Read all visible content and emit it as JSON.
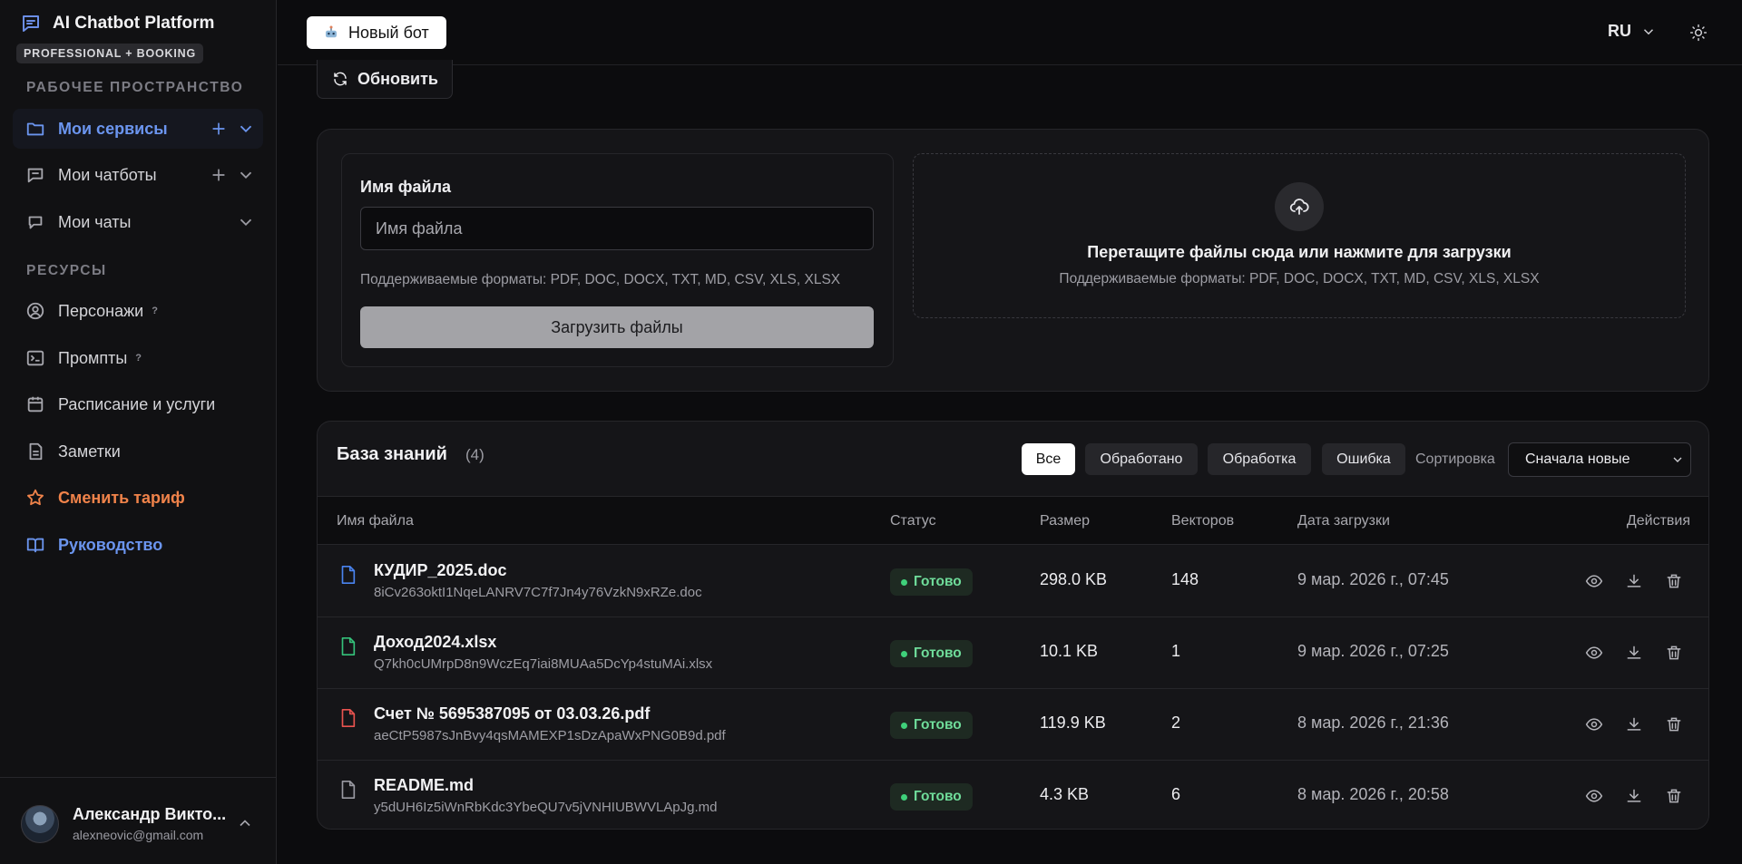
{
  "app": {
    "title": "AI Chatbot Platform",
    "plan_badge": "PROFESSIONAL + BOOKING"
  },
  "sidebar": {
    "workspace_label": "РАБОЧЕЕ ПРОСТРАНСТВО",
    "workspace_items": [
      {
        "label": "Мои сервисы",
        "icon": "folder-icon"
      },
      {
        "label": "Мои чатботы",
        "icon": "chat-icon"
      },
      {
        "label": "Мои чаты",
        "icon": "chat-bubble-icon"
      }
    ],
    "resources_label": "РЕСУРСЫ",
    "resource_items": [
      {
        "label": "Персонажи",
        "help": "?",
        "icon": "person-icon"
      },
      {
        "label": "Промпты",
        "help": "?",
        "icon": "terminal-icon"
      },
      {
        "label": "Расписание и услуги",
        "icon": "calendar-icon"
      },
      {
        "label": "Заметки",
        "icon": "note-icon"
      },
      {
        "label": "Сменить тариф",
        "icon": "star-icon"
      },
      {
        "label": "Руководство",
        "icon": "book-icon"
      }
    ],
    "user": {
      "name": "Александр Викто...",
      "email": "alexneovic@gmail.com"
    }
  },
  "topbar": {
    "new_bot_label": "Новый бот",
    "language": "RU"
  },
  "toolbar": {
    "refresh_label": "Обновить"
  },
  "upload": {
    "field_label": "Имя файла",
    "field_placeholder": "Имя файла",
    "field_value": "",
    "formats": "Поддерживаемые форматы: PDF, DOC, DOCX, TXT, MD, CSV, XLS, XLSX",
    "upload_button": "Загрузить файлы",
    "drop_title": "Перетащите файлы сюда или нажмите для загрузки",
    "drop_formats": "Поддерживаемые форматы: PDF, DOC, DOCX, TXT, MD, CSV, XLS, XLSX"
  },
  "knowledge_base": {
    "title": "База знаний",
    "count": "(4)",
    "filters": [
      "Все",
      "Обработано",
      "Обработка",
      "Ошибка"
    ],
    "active_filter": "Все",
    "sort_label": "Сортировка",
    "sort_value": "Сначала новые",
    "columns": [
      "Имя файла",
      "Статус",
      "Размер",
      "Векторов",
      "Дата загрузки",
      "Действия"
    ],
    "rows": [
      {
        "name": "КУДИР_2025.doc",
        "id": "8iCv263oktI1NqeLANRV7C7f7Jn4y76VzkN9xRZe.doc",
        "status": "Готово",
        "size": "298.0 KB",
        "vectors": "148",
        "date": "9 мар. 2026 г., 07:45",
        "file_color": "#4a84f0"
      },
      {
        "name": "Доход2024.xlsx",
        "id": "Q7kh0cUMrpD8n9WczEq7iai8MUAa5DcYp4stuMAi.xlsx",
        "status": "Готово",
        "size": "10.1 KB",
        "vectors": "1",
        "date": "9 мар. 2026 г., 07:25",
        "file_color": "#35c27a"
      },
      {
        "name": "Счет № 5695387095 от 03.03.26.pdf",
        "id": "aeCtP5987sJnBvy4qsMAMEXP1sDzApaWxPNG0B9d.pdf",
        "status": "Готово",
        "size": "119.9 KB",
        "vectors": "2",
        "date": "8 мар. 2026 г., 21:36",
        "file_color": "#e9534f"
      },
      {
        "name": "README.md",
        "id": "y5dUH6Iz5iWnRbKdc3YbeQU7v5jVNHIUBWVLApJg.md",
        "status": "Готово",
        "size": "4.3 KB",
        "vectors": "6",
        "date": "8 мар. 2026 г., 20:58",
        "file_color": "#9a9aa2"
      }
    ]
  },
  "colors": {
    "accent": "#6b95ef",
    "upgrade": "#f0834a",
    "status_ready": "#3fd07a"
  }
}
